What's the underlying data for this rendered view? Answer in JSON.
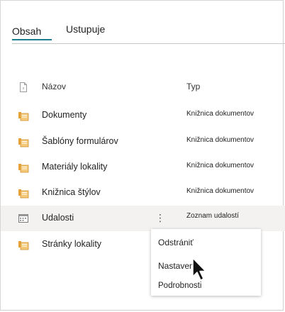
{
  "tabs": [
    {
      "label": "Obsah",
      "active": true
    },
    {
      "label": "Ustupuje",
      "active": false
    }
  ],
  "table": {
    "headers": {
      "name": "Názov",
      "type": "Typ"
    },
    "rows": [
      {
        "name": "Dokumenty",
        "type": "Knižnica dokumentov",
        "icon": "library-icon"
      },
      {
        "name": "Šablóny formulárov",
        "type": "Knižnica dokumentov",
        "icon": "library-icon"
      },
      {
        "name": "Materiály lokality",
        "type": "Knižnica dokumentov",
        "icon": "library-icon"
      },
      {
        "name": "Knižnica štýlov",
        "type": "Knižnica dokumentov",
        "icon": "library-icon"
      },
      {
        "name": "Udalosti",
        "type": "Zoznam udalostí",
        "icon": "calendar-list-icon",
        "selected": true,
        "more": "⋮"
      },
      {
        "name": "Stránky lokality",
        "type": "",
        "icon": "library-icon"
      }
    ]
  },
  "context_menu": {
    "items": [
      "Odstrániť",
      "Nastavenia",
      "Podrobnosti"
    ]
  },
  "colors": {
    "accent": "#1a7f8e",
    "library_icon": "#e8a33a",
    "selected_row": "#f3f2f1"
  }
}
